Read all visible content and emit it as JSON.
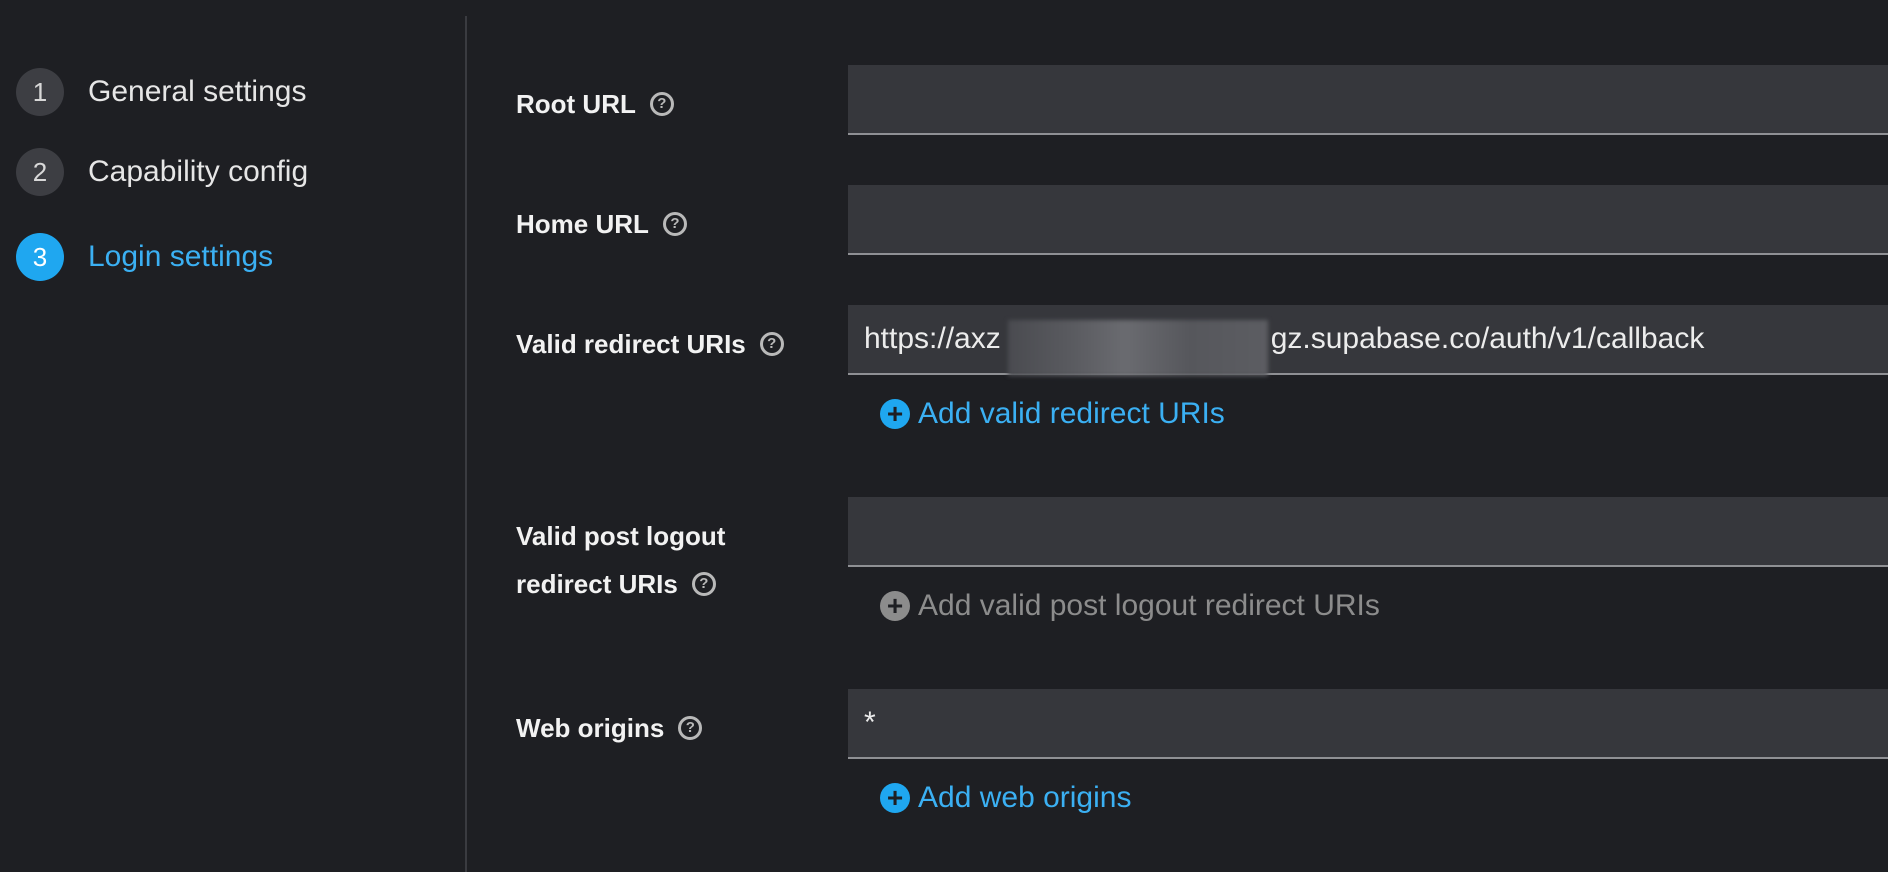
{
  "steps": [
    {
      "number": "1",
      "label": "General settings"
    },
    {
      "number": "2",
      "label": "Capability config"
    },
    {
      "number": "3",
      "label": "Login settings"
    }
  ],
  "active_step": 3,
  "colors": {
    "accent": "#1fa7f0",
    "background": "#1e1f23",
    "field_background": "#36373c",
    "disabled_text": "#8c8c8c"
  },
  "form": {
    "root_url": {
      "label": "Root URL",
      "value": "",
      "help_icon": "question-circle-icon"
    },
    "home_url": {
      "label": "Home URL",
      "value": "",
      "help_icon": "question-circle-icon"
    },
    "redirect_uris": {
      "label": "Valid redirect URIs",
      "value": "https://axz         gz.supabase.co/auth/v1/callback",
      "help_icon": "question-circle-icon",
      "add_label": "Add valid redirect URIs"
    },
    "post_logout_uris": {
      "label_line1": "Valid post logout",
      "label_line2": "redirect URIs",
      "value": "",
      "help_icon": "question-circle-icon",
      "add_label": "Add valid post logout redirect URIs",
      "add_disabled": true
    },
    "web_origins": {
      "label": "Web origins",
      "value": "*",
      "help_icon": "question-circle-icon",
      "add_label": "Add web origins"
    }
  },
  "icons": {
    "help": "?",
    "plus": "+"
  }
}
